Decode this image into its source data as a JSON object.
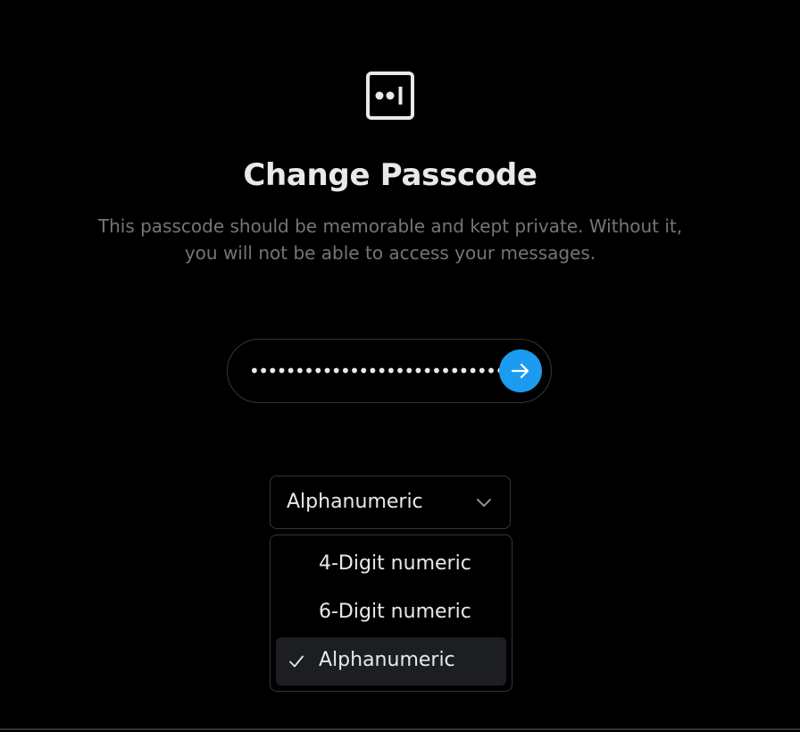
{
  "header": {
    "icon": "passcode-logo-icon",
    "title": "Change Passcode",
    "description": "This passcode should be memorable and kept private. Without it, you will not be able to access your messages."
  },
  "passcode": {
    "masked_value": "••••••••••••••••••••••••••••",
    "submit_icon": "arrow-right-icon",
    "accent_color": "#1d9bf0"
  },
  "type_select": {
    "selected_value": "Alphanumeric",
    "icon": "chevron-down-icon",
    "options": [
      {
        "label": "4-Digit numeric",
        "selected": false
      },
      {
        "label": "6-Digit numeric",
        "selected": false
      },
      {
        "label": "Alphanumeric",
        "selected": true
      }
    ]
  }
}
